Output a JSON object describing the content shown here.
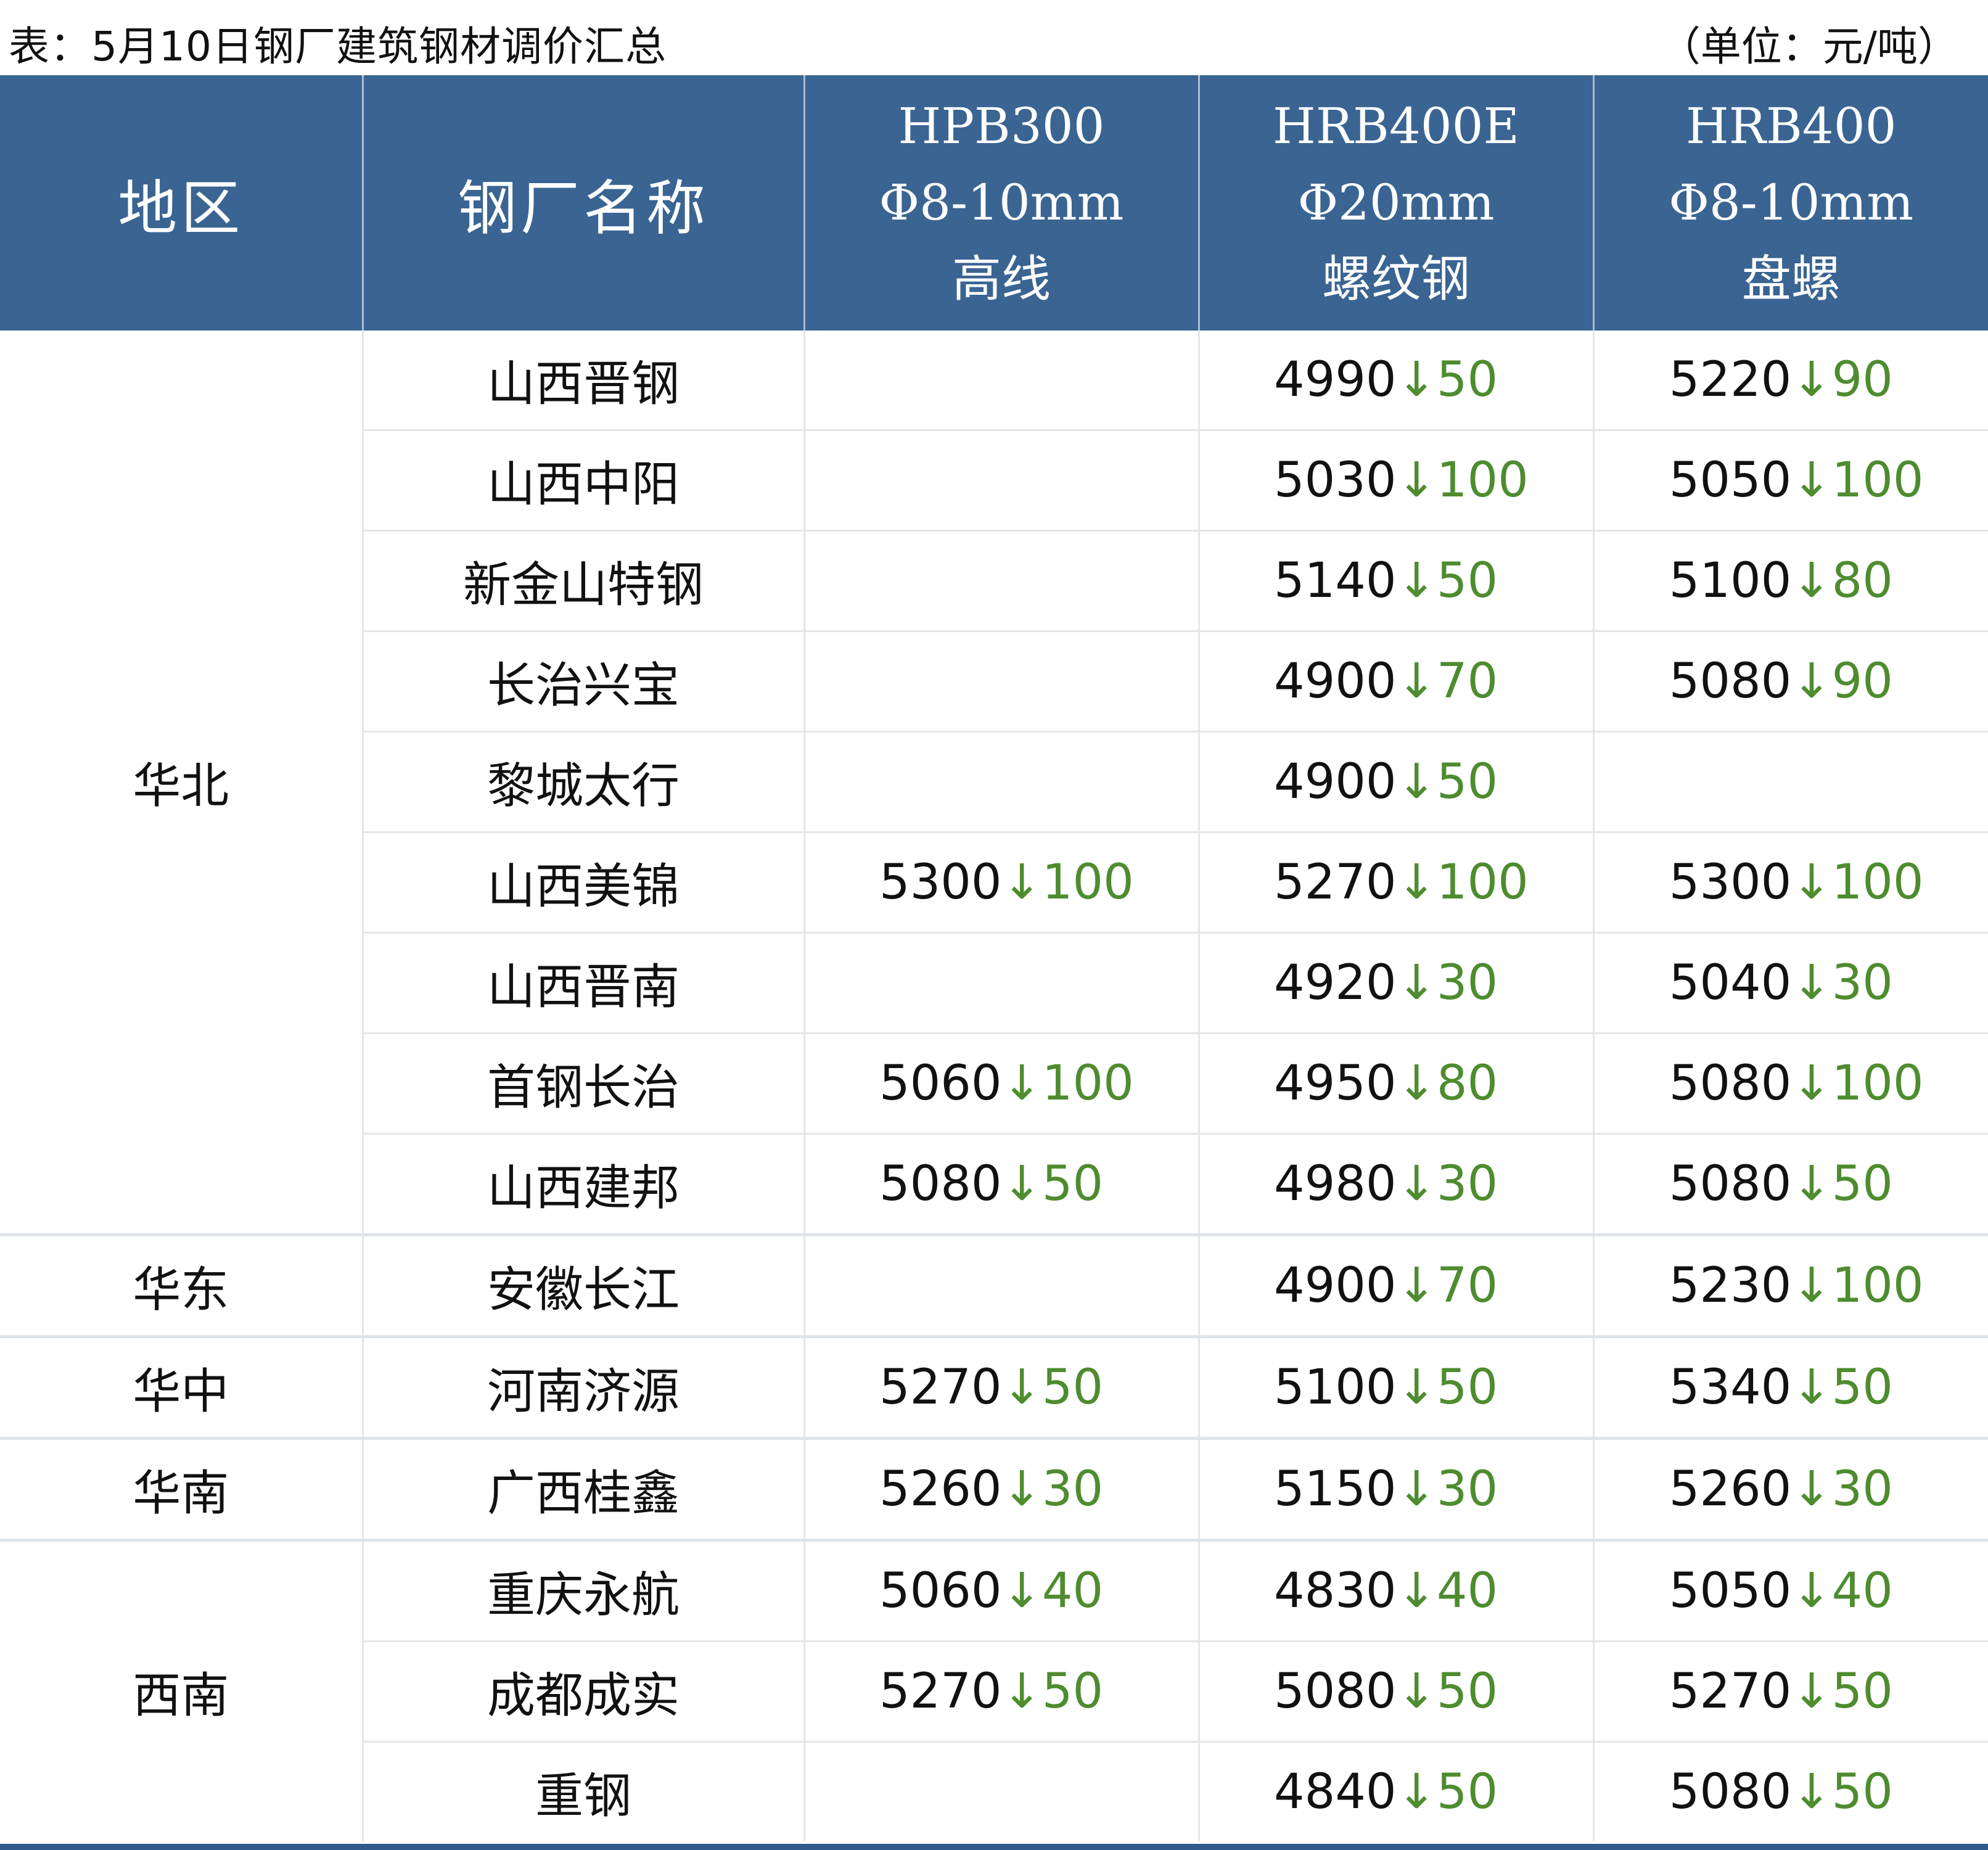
{
  "caption": {
    "title": "表：5月10日钢厂建筑钢材调价汇总",
    "unit": "（单位：元/吨）"
  },
  "headers": {
    "region": "地区",
    "mill": "钢厂名称",
    "p1": {
      "grade": "HPB300",
      "spec": "Φ8-10mm",
      "type": "高线"
    },
    "p2": {
      "grade": "HRB400E",
      "spec": "Φ20mm",
      "type": "螺纹钢"
    },
    "p3": {
      "grade": "HRB400",
      "spec": "Φ8-10mm",
      "type": "盘螺"
    }
  },
  "regions": {
    "north": "华北",
    "east": "华东",
    "central": "华中",
    "south": "华南",
    "southwest": "西南"
  },
  "arrow": "↓",
  "rows": [
    {
      "mill": "山西晋钢",
      "p1": null,
      "p1c": null,
      "p2": "4990",
      "p2c": "50",
      "p3": "5220",
      "p3c": "90"
    },
    {
      "mill": "山西中阳",
      "p1": null,
      "p1c": null,
      "p2": "5030",
      "p2c": "100",
      "p3": "5050",
      "p3c": "100"
    },
    {
      "mill": "新金山特钢",
      "p1": null,
      "p1c": null,
      "p2": "5140",
      "p2c": "50",
      "p3": "5100",
      "p3c": "80"
    },
    {
      "mill": "长治兴宝",
      "p1": null,
      "p1c": null,
      "p2": "4900",
      "p2c": "70",
      "p3": "5080",
      "p3c": "90"
    },
    {
      "mill": "黎城太行",
      "p1": null,
      "p1c": null,
      "p2": "4900",
      "p2c": "50",
      "p3": null,
      "p3c": null
    },
    {
      "mill": "山西美锦",
      "p1": "5300",
      "p1c": "100",
      "p2": "5270",
      "p2c": "100",
      "p3": "5300",
      "p3c": "100"
    },
    {
      "mill": "山西晋南",
      "p1": null,
      "p1c": null,
      "p2": "4920",
      "p2c": "30",
      "p3": "5040",
      "p3c": "30"
    },
    {
      "mill": "首钢长治",
      "p1": "5060",
      "p1c": "100",
      "p2": "4950",
      "p2c": "80",
      "p3": "5080",
      "p3c": "100"
    },
    {
      "mill": "山西建邦",
      "p1": "5080",
      "p1c": "50",
      "p2": "4980",
      "p2c": "30",
      "p3": "5080",
      "p3c": "50"
    },
    {
      "mill": "安徽长江",
      "p1": null,
      "p1c": null,
      "p2": "4900",
      "p2c": "70",
      "p3": "5230",
      "p3c": "100"
    },
    {
      "mill": "河南济源",
      "p1": "5270",
      "p1c": "50",
      "p2": "5100",
      "p2c": "50",
      "p3": "5340",
      "p3c": "50"
    },
    {
      "mill": "广西桂鑫",
      "p1": "5260",
      "p1c": "30",
      "p2": "5150",
      "p2c": "30",
      "p3": "5260",
      "p3c": "30"
    },
    {
      "mill": "重庆永航",
      "p1": "5060",
      "p1c": "40",
      "p2": "4830",
      "p2c": "40",
      "p3": "5050",
      "p3c": "40"
    },
    {
      "mill": "成都成实",
      "p1": "5270",
      "p1c": "50",
      "p2": "5080",
      "p2c": "50",
      "p3": "5270",
      "p3c": "50"
    },
    {
      "mill": "重钢",
      "p1": null,
      "p1c": null,
      "p2": "4840",
      "p2c": "50",
      "p3": "5080",
      "p3c": "50"
    }
  ],
  "colors": {
    "header_bg": "#3a6492",
    "decrease": "#4e8c2f",
    "bottom_rule": "#2f5b8c"
  }
}
